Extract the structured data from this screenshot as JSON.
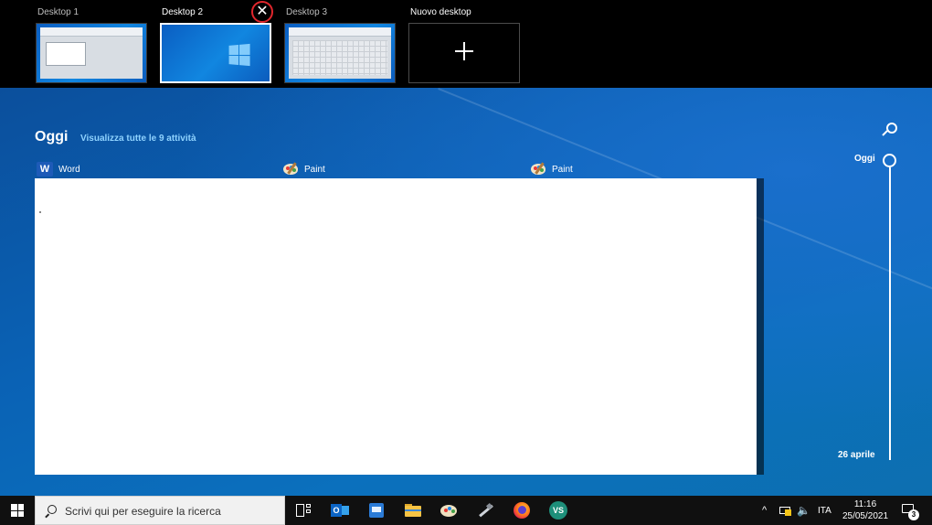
{
  "desktops": [
    {
      "label": "Desktop 1",
      "active": false
    },
    {
      "label": "Desktop 2",
      "active": true
    },
    {
      "label": "Desktop 3",
      "active": false
    }
  ],
  "new_desktop_label": "Nuovo desktop",
  "close_glyph": "✕",
  "timeline": {
    "title": "Oggi",
    "see_all": "Visualizza tutte le 9 attività",
    "apps": [
      {
        "name": "Word",
        "icon": "word-icon"
      },
      {
        "name": "Paint",
        "icon": "paint-icon"
      },
      {
        "name": "Paint",
        "icon": "paint-icon"
      }
    ],
    "scrubber_top_label": "Oggi",
    "scrubber_bottom_label": "26 aprile"
  },
  "taskbar": {
    "search_placeholder": "Scrivi qui per eseguire la ricerca",
    "outlook_letter": "O",
    "vs_letters": "VS",
    "tray_arrow": "^",
    "volume_glyph": "🔈",
    "language": "ITA",
    "time": "11:16",
    "date": "25/05/2021",
    "notification_count": "3"
  },
  "colors": {
    "close_ring": "#e0262c",
    "accent_link": "#8fd3ff"
  }
}
